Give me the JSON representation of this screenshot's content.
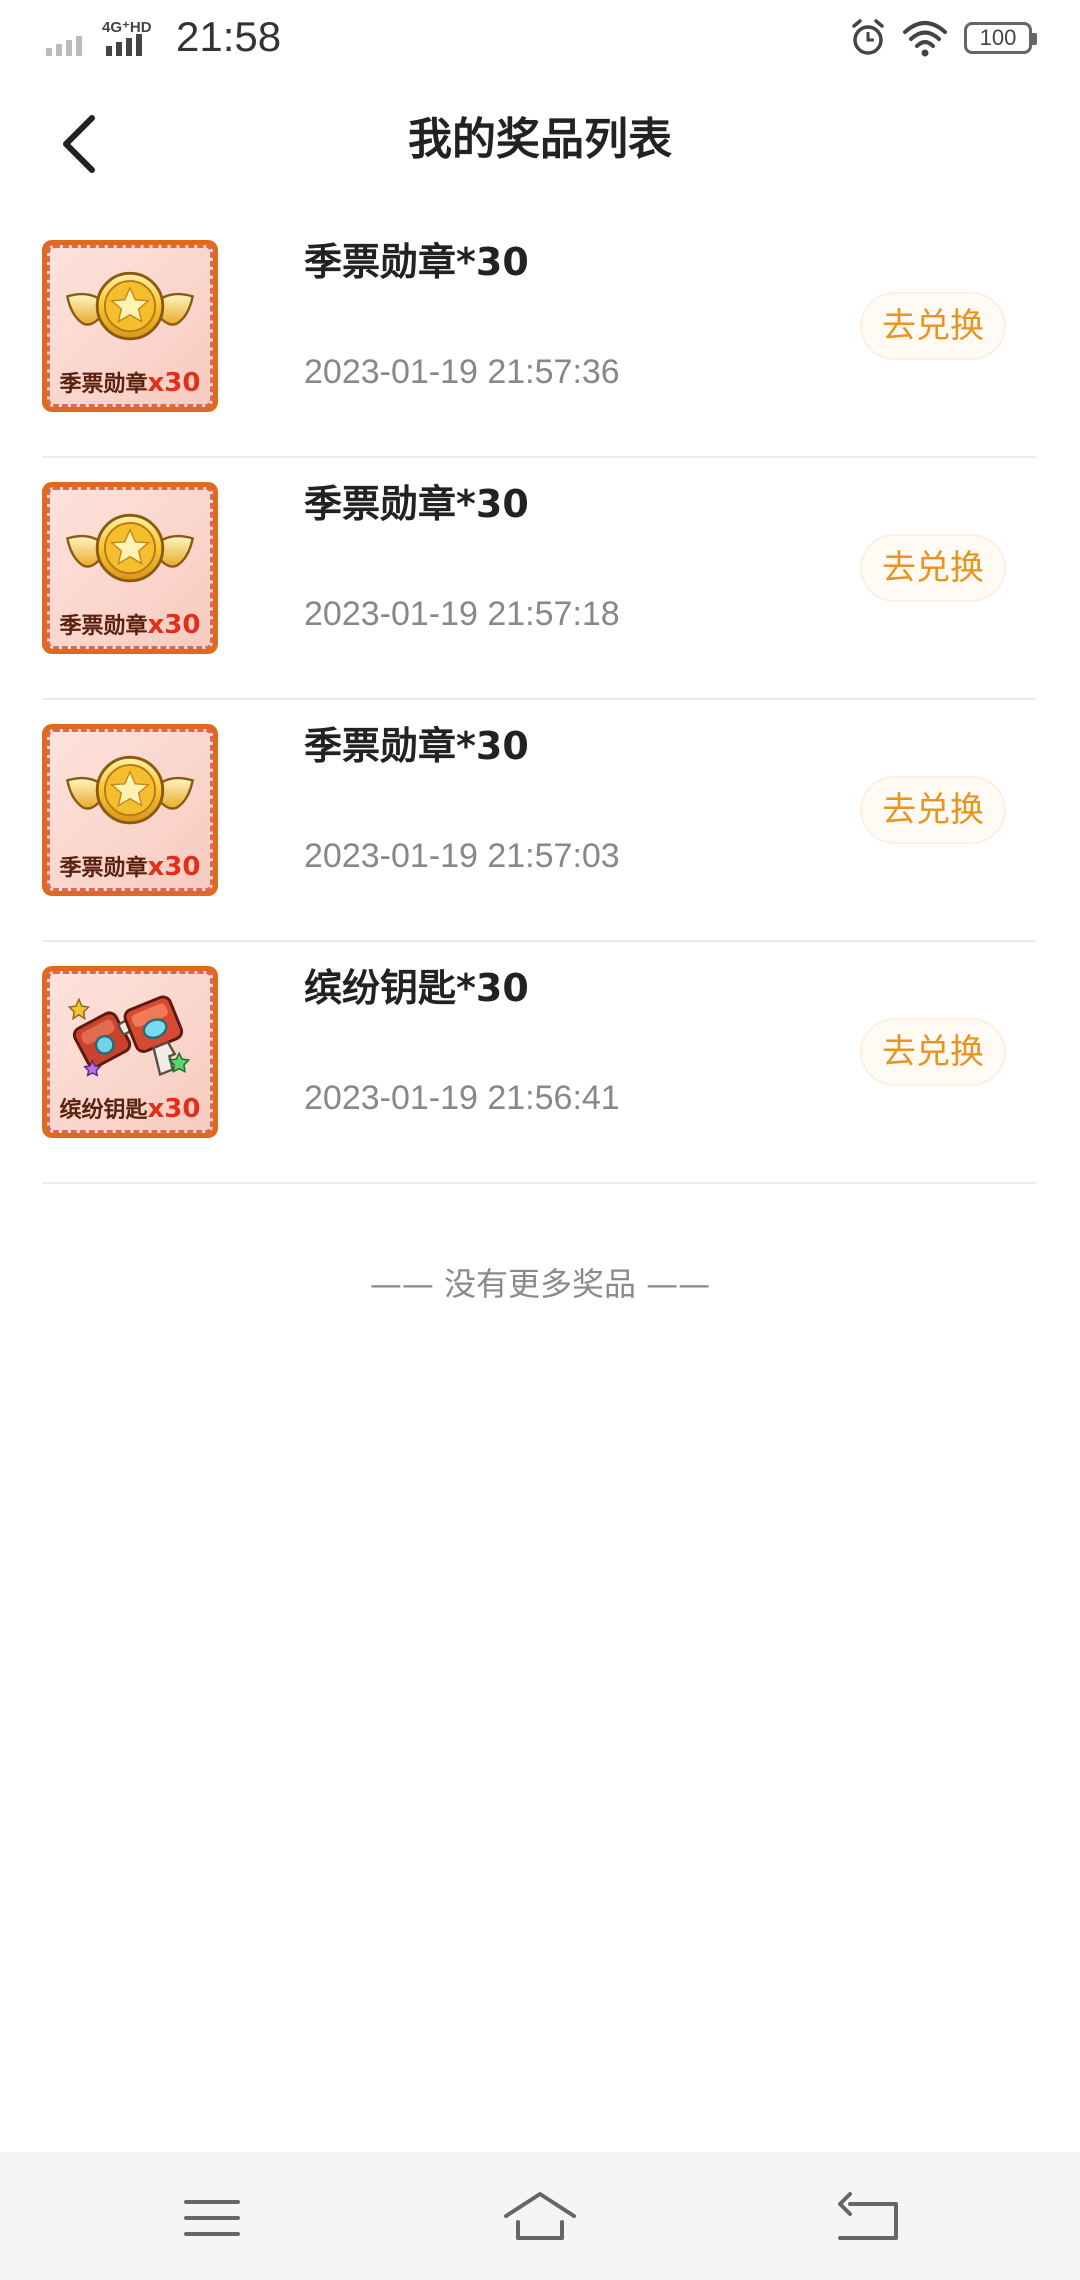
{
  "status_bar": {
    "network": "4G⁺HD",
    "time": "21:58",
    "battery": "100"
  },
  "header": {
    "title": "我的奖品列表"
  },
  "prizes": [
    {
      "name": "季票勋章*30",
      "time": "2023-01-19 21:57:36",
      "action": "去兑换",
      "thumb_label": "季票勋章",
      "thumb_qty": "x30",
      "icon": "winged-medal-icon"
    },
    {
      "name": "季票勋章*30",
      "time": "2023-01-19 21:57:18",
      "action": "去兑换",
      "thumb_label": "季票勋章",
      "thumb_qty": "x30",
      "icon": "winged-medal-icon"
    },
    {
      "name": "季票勋章*30",
      "time": "2023-01-19 21:57:03",
      "action": "去兑换",
      "thumb_label": "季票勋章",
      "thumb_qty": "x30",
      "icon": "winged-medal-icon"
    },
    {
      "name": "缤纷钥匙*30",
      "time": "2023-01-19 21:56:41",
      "action": "去兑换",
      "thumb_label": "缤纷钥匙",
      "thumb_qty": "x30",
      "icon": "colorful-key-icon"
    }
  ],
  "footer_note": "—— 没有更多奖品 ——",
  "colors": {
    "accent": "#e8941f",
    "thumb_border": "#e0691e",
    "quantity_red": "#e0301a"
  }
}
